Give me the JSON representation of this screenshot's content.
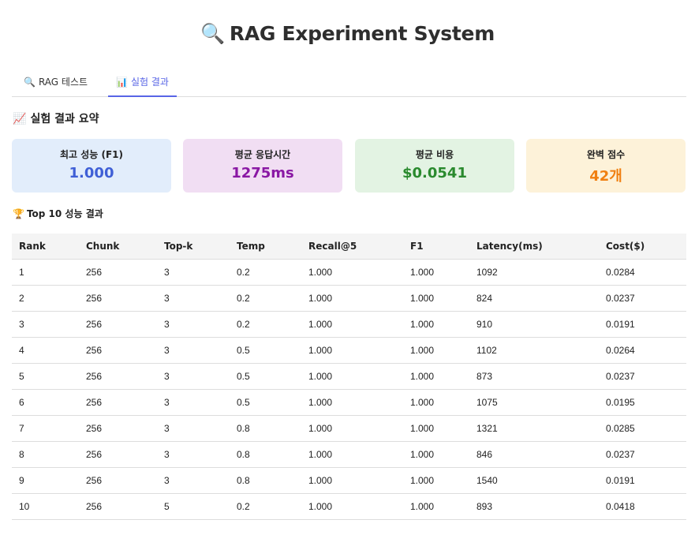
{
  "app": {
    "title_icon": "🔍",
    "title": "RAG Experiment System"
  },
  "tabs": [
    {
      "icon": "🔍",
      "label": "RAG 테스트",
      "active": false
    },
    {
      "icon": "📊",
      "label": "실험 결과",
      "active": true
    }
  ],
  "summary": {
    "icon": "📈",
    "title": "실험 결과 요약",
    "cards": [
      {
        "label": "최고 성능 (F1)",
        "value": "1.000",
        "color": "#3f5fd6"
      },
      {
        "label": "평균 응답시간",
        "value": "1275ms",
        "color": "#8a18a4"
      },
      {
        "label": "평균 비용",
        "value": "$0.0541",
        "color": "#2a8a2e"
      },
      {
        "label": "완벽 점수",
        "value": "42개",
        "color": "#f07f10"
      }
    ]
  },
  "top10": {
    "icon": "🏆",
    "title": "Top 10 성능 결과",
    "columns": [
      "Rank",
      "Chunk",
      "Top-k",
      "Temp",
      "Recall@5",
      "F1",
      "Latency(ms)",
      "Cost($)"
    ],
    "rows": [
      [
        "1",
        "256",
        "3",
        "0.2",
        "1.000",
        "1.000",
        "1092",
        "0.0284"
      ],
      [
        "2",
        "256",
        "3",
        "0.2",
        "1.000",
        "1.000",
        "824",
        "0.0237"
      ],
      [
        "3",
        "256",
        "3",
        "0.2",
        "1.000",
        "1.000",
        "910",
        "0.0191"
      ],
      [
        "4",
        "256",
        "3",
        "0.5",
        "1.000",
        "1.000",
        "1102",
        "0.0264"
      ],
      [
        "5",
        "256",
        "3",
        "0.5",
        "1.000",
        "1.000",
        "873",
        "0.0237"
      ],
      [
        "6",
        "256",
        "3",
        "0.5",
        "1.000",
        "1.000",
        "1075",
        "0.0195"
      ],
      [
        "7",
        "256",
        "3",
        "0.8",
        "1.000",
        "1.000",
        "1321",
        "0.0285"
      ],
      [
        "8",
        "256",
        "3",
        "0.8",
        "1.000",
        "1.000",
        "846",
        "0.0237"
      ],
      [
        "9",
        "256",
        "3",
        "0.8",
        "1.000",
        "1.000",
        "1540",
        "0.0191"
      ],
      [
        "10",
        "256",
        "5",
        "0.2",
        "1.000",
        "1.000",
        "893",
        "0.0418"
      ]
    ]
  }
}
